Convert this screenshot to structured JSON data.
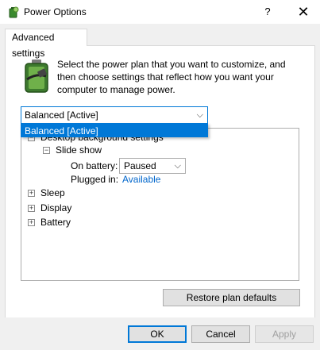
{
  "window": {
    "title": "Power Options",
    "help_glyph": "?",
    "close_glyph": "✕"
  },
  "tab": {
    "label": "Advanced settings"
  },
  "intro": "Select the power plan that you want to customize, and then choose settings that reflect how you want your computer to manage power.",
  "plan_dropdown": {
    "selected": "Balanced [Active]",
    "options": [
      "Balanced [Active]"
    ]
  },
  "tree": {
    "desktop_background": {
      "label": "Desktop background settings",
      "expander": "−"
    },
    "slide_show": {
      "label": "Slide show",
      "expander": "−"
    },
    "on_battery": {
      "label": "On battery:",
      "value": "Paused"
    },
    "plugged_in": {
      "label": "Plugged in:",
      "value": "Available"
    },
    "sleep": {
      "label": "Sleep",
      "expander": "+"
    },
    "display": {
      "label": "Display",
      "expander": "+"
    },
    "battery": {
      "label": "Battery",
      "expander": "+"
    }
  },
  "buttons": {
    "restore": "Restore plan defaults",
    "ok": "OK",
    "cancel": "Cancel",
    "apply": "Apply"
  },
  "colors": {
    "accent": "#0078d7",
    "link": "#0066cc"
  },
  "icons": {
    "app": "power-options-icon",
    "battery": "battery-plug-icon",
    "chevron": "chevron-down-icon"
  }
}
